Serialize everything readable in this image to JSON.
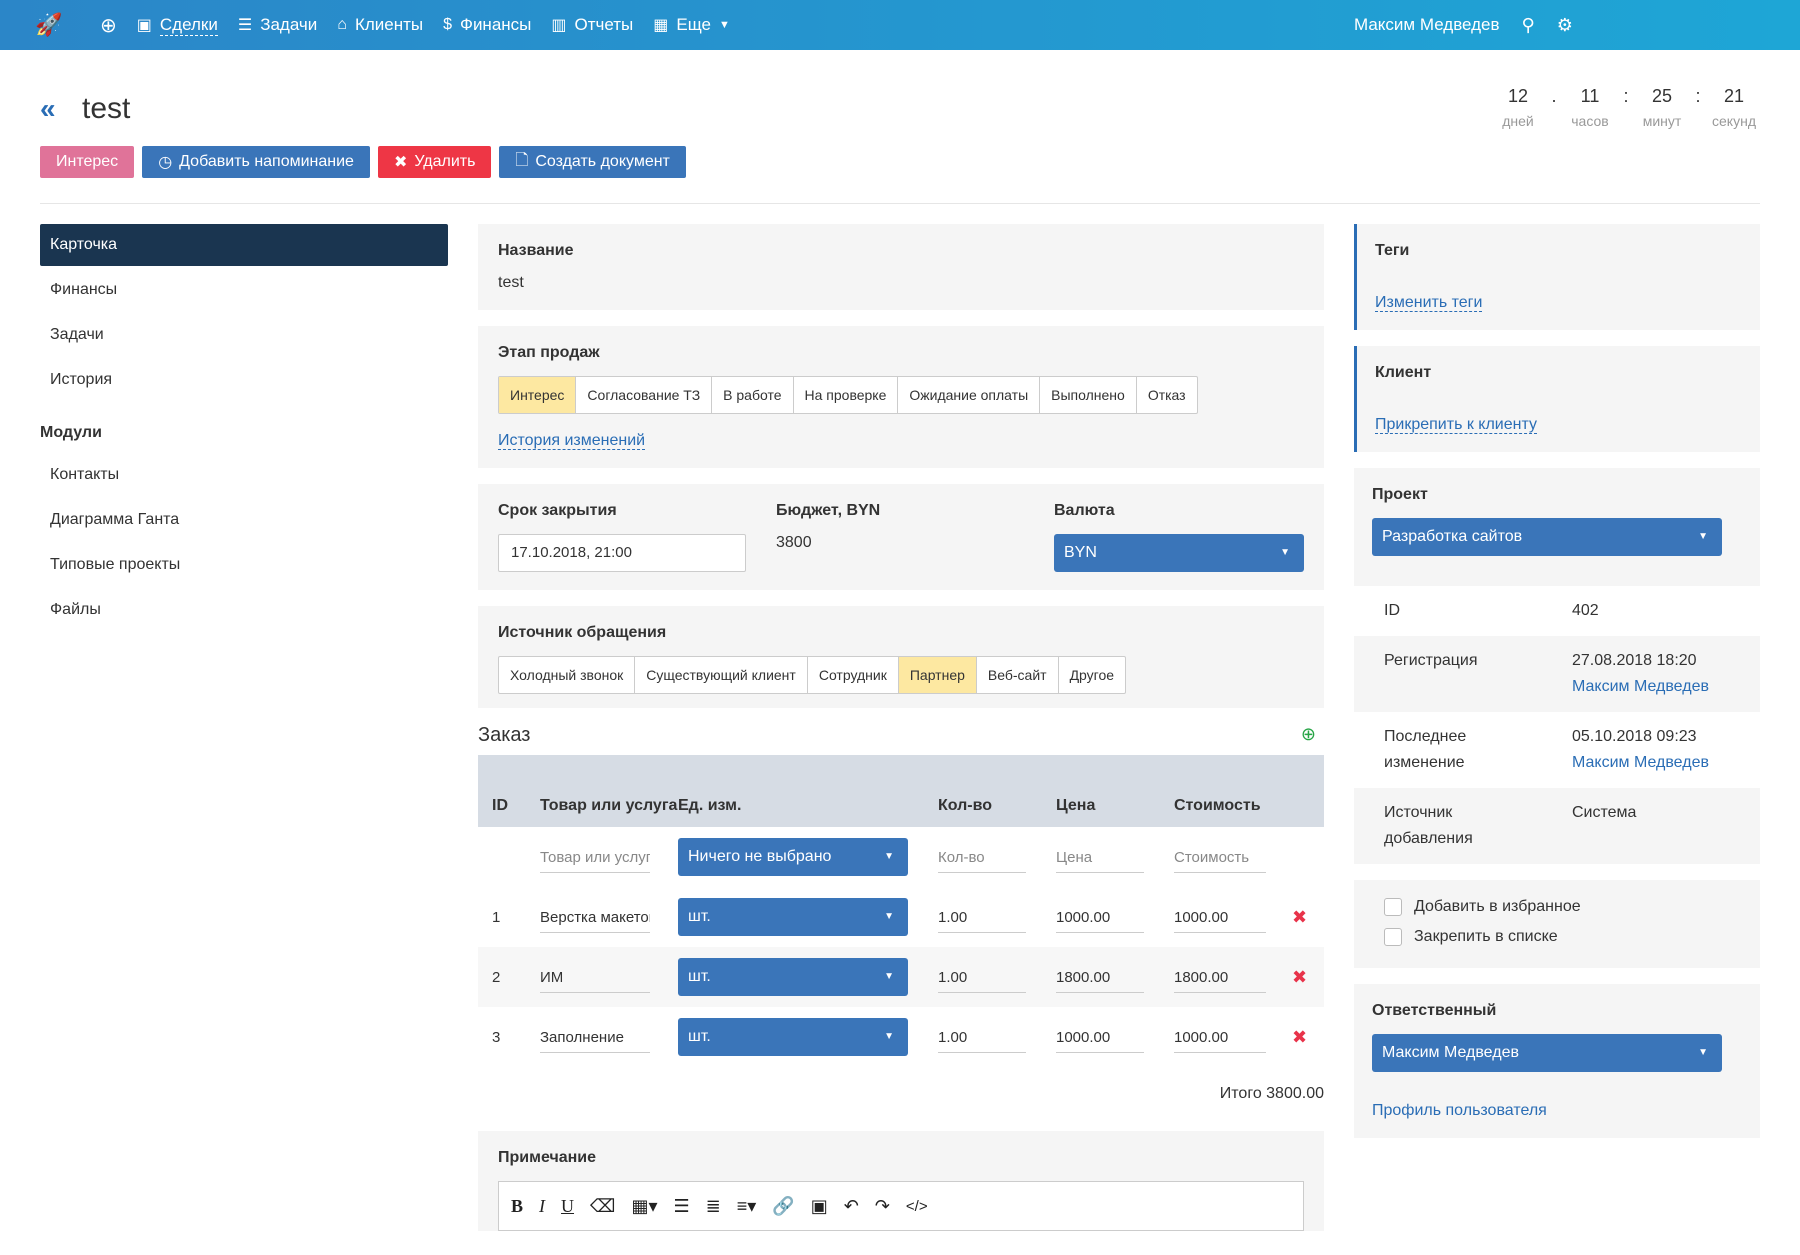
{
  "topbar": {
    "nav": [
      {
        "icon": "briefcase-icon",
        "label": "Сделки",
        "active": true
      },
      {
        "icon": "list-icon",
        "label": "Задачи"
      },
      {
        "icon": "bank-icon",
        "label": "Клиенты"
      },
      {
        "icon": "dollar-icon",
        "label": "Финансы"
      },
      {
        "icon": "bar-chart-icon",
        "label": "Отчеты"
      },
      {
        "icon": "grid-icon",
        "label": "Еще"
      }
    ],
    "user": "Максим Медведев"
  },
  "header": {
    "title": "test"
  },
  "buttons": {
    "interest": "Интерес",
    "reminder": "Добавить напоминание",
    "delete": "Удалить",
    "document": "Создать документ"
  },
  "timer": {
    "days": "12",
    "hours": "11",
    "minutes": "25",
    "seconds": "21",
    "days_label": "дней",
    "hours_label": "часов",
    "minutes_label": "минут",
    "seconds_label": "секунд"
  },
  "sidebar": {
    "items": [
      "Карточка",
      "Финансы",
      "Задачи",
      "История"
    ],
    "modules_heading": "Модули",
    "modules": [
      "Контакты",
      "Диаграмма Ганта",
      "Типовые проекты",
      "Файлы"
    ]
  },
  "main": {
    "name_label": "Название",
    "name_value": "test",
    "stage_label": "Этап продаж",
    "stages": [
      "Интерес",
      "Согласование ТЗ",
      "В работе",
      "На проверке",
      "Ожидание оплаты",
      "Выполнено",
      "Отказ"
    ],
    "active_stage": 0,
    "history_link": "История изменений",
    "close_label": "Срок закрытия",
    "close_value": "17.10.2018, 21:00",
    "budget_label": "Бюджет, BYN",
    "budget_value": "3800",
    "currency_label": "Валюта",
    "currency_value": "BYN",
    "source_label": "Источник обращения",
    "sources": [
      "Холодный звонок",
      "Существующий клиент",
      "Сотрудник",
      "Партнер",
      "Веб-сайт",
      "Другое"
    ],
    "active_source": 3
  },
  "order": {
    "title": "Заказ",
    "columns": {
      "id": "ID",
      "product": "Товар или услуга",
      "unit": "Ед. изм.",
      "qty": "Кол-во",
      "price": "Цена",
      "cost": "Стоимость"
    },
    "new_row": {
      "product_ph": "Товар или услуга",
      "unit": "Ничего не выбрано",
      "qty_ph": "Кол-во",
      "price_ph": "Цена",
      "cost_ph": "Стоимость"
    },
    "rows": [
      {
        "id": "1",
        "product": "Верстка макетов",
        "unit": "шт.",
        "qty": "1.00",
        "price": "1000.00",
        "cost": "1000.00"
      },
      {
        "id": "2",
        "product": "ИМ",
        "unit": "шт.",
        "qty": "1.00",
        "price": "1800.00",
        "cost": "1800.00"
      },
      {
        "id": "3",
        "product": "Заполнение",
        "unit": "шт.",
        "qty": "1.00",
        "price": "1000.00",
        "cost": "1000.00"
      }
    ],
    "total": "Итого 3800.00"
  },
  "note": {
    "label": "Примечание"
  },
  "right": {
    "tags_label": "Теги",
    "tags_link": "Изменить теги",
    "client_label": "Клиент",
    "client_link": "Прикрепить к клиенту",
    "project_label": "Проект",
    "project_value": "Разработка сайтов",
    "id_label": "ID",
    "id_value": "402",
    "reg_label": "Регистрация",
    "reg_date": "27.08.2018 18:20",
    "reg_user": "Максим Медведев",
    "mod_label": "Последнее изменение",
    "mod_date": "05.10.2018 09:23",
    "mod_user": "Максим Медведев",
    "src_label": "Источник добавления",
    "src_value": "Система",
    "fav_label": "Добавить в избранное",
    "pin_label": "Закрепить в списке",
    "resp_label": "Ответственный",
    "resp_value": "Максим Медведев",
    "profile_link": "Профиль пользователя"
  }
}
